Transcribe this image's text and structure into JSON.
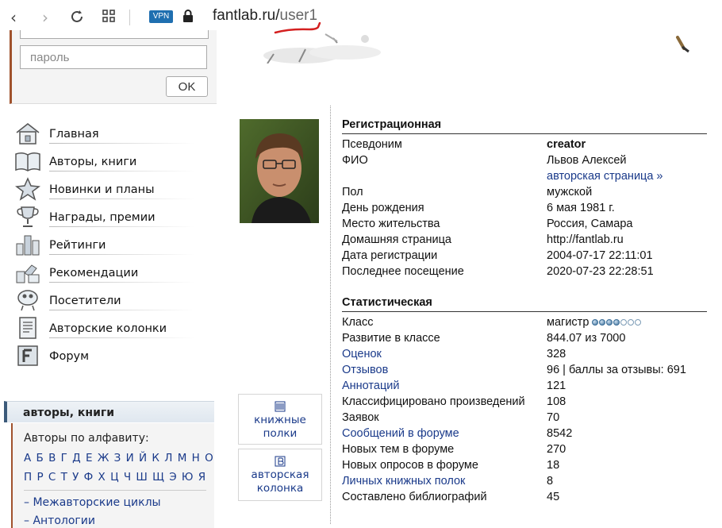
{
  "browser": {
    "vpn_badge": "VPN",
    "url_host": "fantlab.ru/",
    "url_path": "user1",
    "underline_color": "#d42020"
  },
  "login": {
    "password_placeholder": "пароль",
    "ok_label": "OK"
  },
  "nav": {
    "items": [
      {
        "label": "Главная",
        "icon": "house-icon"
      },
      {
        "label": "Авторы, книги",
        "icon": "open-book-icon"
      },
      {
        "label": "Новинки и планы",
        "icon": "star-icon"
      },
      {
        "label": "Награды, премии",
        "icon": "trophy-icon"
      },
      {
        "label": "Рейтинги",
        "icon": "rating-bars-icon"
      },
      {
        "label": "Рекомендации",
        "icon": "recommend-icon"
      },
      {
        "label": "Посетители",
        "icon": "visitor-icon"
      },
      {
        "label": "Авторские колонки",
        "icon": "column-doc-icon"
      },
      {
        "label": "Форум",
        "icon": "forum-icon"
      }
    ]
  },
  "authors_box": {
    "title": "авторы, книги",
    "alphabet_title": "Авторы по алфавиту:",
    "letters_row1": "А Б В Г Д Е Ж З И Й К Л М Н О",
    "letters_row2": "П Р С Т У Ф Х Ц Ч Ш Щ Э Ю Я",
    "cycles": "– Межавторские циклы",
    "anthologies": "– Антологии"
  },
  "buttons": {
    "shelves": "книжные полки",
    "column": "авторская колонка"
  },
  "profile": {
    "registration_title": "Регистрационная",
    "registration": [
      {
        "key": "Псевдоним",
        "value": "creator",
        "value_style": "bold"
      },
      {
        "key": "ФИО",
        "value": "Львов Алексей"
      },
      {
        "key": "",
        "value": "авторская страница »",
        "value_style": "link"
      },
      {
        "key": "Пол",
        "value": "мужской"
      },
      {
        "key": "День рождения",
        "value": "6 мая 1981 г."
      },
      {
        "key": "Место жительства",
        "value": "Россия, Самара"
      },
      {
        "key": "Домашняя страница",
        "value": "http://fantlab.ru"
      },
      {
        "key": "Дата регистрации",
        "value": "2004-07-17 22:11:01"
      },
      {
        "key": "Последнее посещение",
        "value": "2020-07-23 22:28:51"
      }
    ],
    "stats_title": "Статистическая",
    "stats": [
      {
        "key": "Класс",
        "value": "магистр",
        "level_filled": 4,
        "level_total": 7
      },
      {
        "key": "Развитие в классе",
        "value": "844.07 из 7000"
      },
      {
        "key": "Оценок",
        "value": "328",
        "key_style": "link"
      },
      {
        "key": "Отзывов",
        "value": "96  |  баллы за отзывы: 691",
        "key_style": "link"
      },
      {
        "key": "Аннотаций",
        "value": "121",
        "key_style": "link"
      },
      {
        "key": "Классифицировано произведений",
        "value": "108"
      },
      {
        "key": "Заявок",
        "value": "70"
      },
      {
        "key": "Сообщений в форуме",
        "value": "8542",
        "key_style": "link"
      },
      {
        "key": "Новых тем в форуме",
        "value": "270"
      },
      {
        "key": "Новых опросов в форуме",
        "value": "18"
      },
      {
        "key": "Личных книжных полок",
        "value": "8",
        "key_style": "link"
      },
      {
        "key": "Составлено библиографий",
        "value": "45"
      }
    ]
  }
}
